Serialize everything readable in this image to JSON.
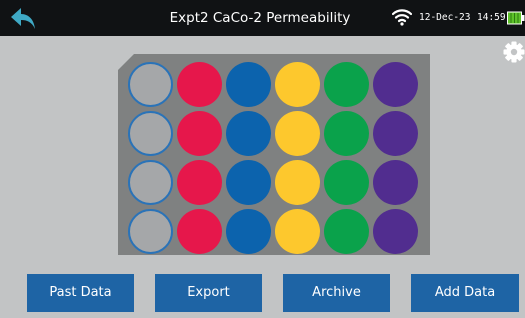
{
  "status_bar": {
    "title": "Expt2 CaCo-2 Permeability",
    "date": "12-Dec-23",
    "time": "14:59",
    "battery_level": 1.0,
    "icons": [
      "back-arrow-icon",
      "wifi-icon",
      "battery-icon"
    ]
  },
  "settings": {
    "icon": "gear-icon"
  },
  "plate": {
    "rows": 4,
    "columns": 6,
    "column_colors": [
      "#a5a7a9",
      "#e6174b",
      "#0c63ad",
      "#fdc82d",
      "#0aa24b",
      "#512d8f"
    ],
    "empty_column_border": "#2a73b8"
  },
  "actions": {
    "past_data_label": "Past Data",
    "export_label": "Export",
    "archive_label": "Archive",
    "add_data_label": "Add Data"
  },
  "colors": {
    "top_bar": "#101214",
    "background": "#c2c4c5",
    "plate": "#7f8181",
    "button": "#1e64a5",
    "accent": "#3fa9c5",
    "battery": "#5ec22a"
  }
}
